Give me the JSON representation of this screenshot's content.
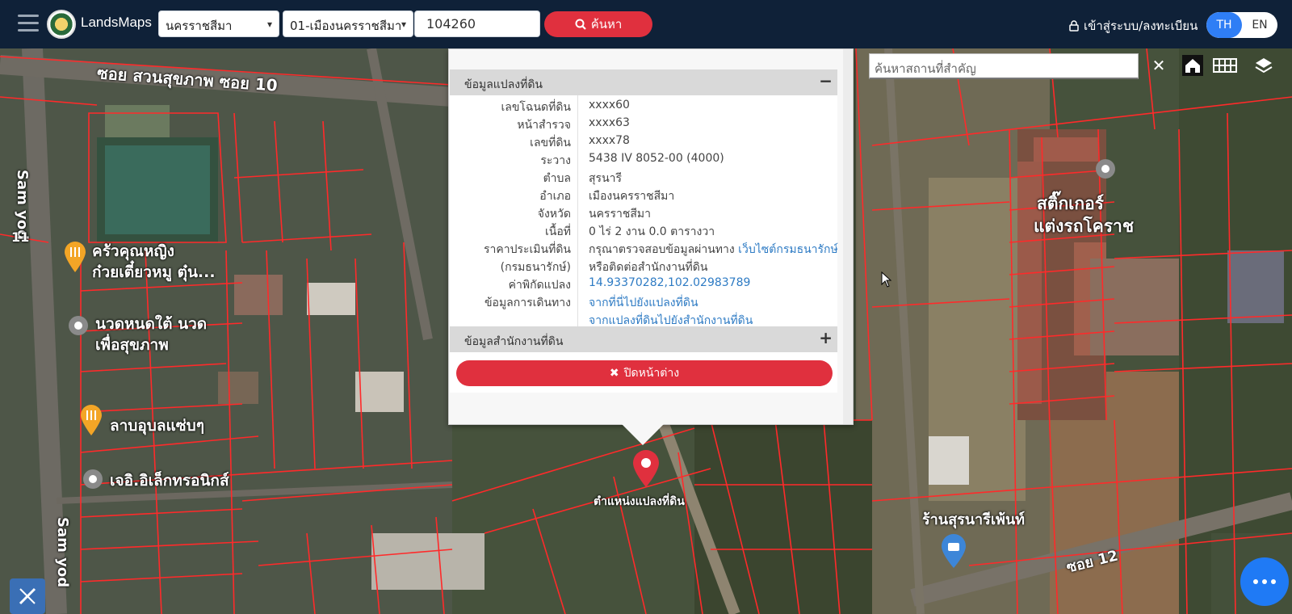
{
  "header": {
    "brand": "LandsMaps",
    "province": "นครราชสีมา",
    "district": "01-เมืองนครราชสีมา",
    "parcel_number": "104260",
    "search_label": "ค้นหา",
    "login_label": "เข้าสู่ระบบ/ลงทะเบียน",
    "lang_th": "TH",
    "lang_en": "EN"
  },
  "map": {
    "place_search_placeholder": "ค้นหาสถานที่สำคัญ",
    "labels": {
      "soi_suansuk": "ซอย สวนสุขภาพ ซอย 10",
      "sam_yod_top": "Sam yod",
      "sam_yod_bottom": "Sam yod",
      "num_11": "11",
      "restaurant": "ครัวคุณหญิง",
      "restaurant2": "ก๋วยเตี๋ยวหมู ตุ๋น...",
      "massage": "นวดหนดใต้ นวด",
      "massage2": "เพื่อสุขภาพ",
      "laab": "ลาบอุบลแซ่บๆ",
      "electronics": "เจอิ.อิเล็กทรอนิกส์",
      "sticker": "สติ๊กเกอร์",
      "sticker2": "แต่งรถโคราช",
      "paint_shop": "ร้านสุรนารีเพ้นท์",
      "soi12": "ซอย 12",
      "pin_label": "ตำแหน่งแปลงที่ดิน"
    }
  },
  "popup": {
    "section_parcel": "ข้อมูลแปลงที่ดิน",
    "section_office": "ข้อมูลสำนักงานที่ดิน",
    "close_label": "ปิดหน้าต่าง",
    "rows": [
      {
        "k": "เลขโฉนดที่ดิน",
        "v": "xxxx60"
      },
      {
        "k": "หน้าสำรวจ",
        "v": "xxxx63"
      },
      {
        "k": "เลขที่ดิน",
        "v": "xxxx78"
      },
      {
        "k": "ระวาง",
        "v": "5438 IV 8052-00 (4000)"
      },
      {
        "k": "ตำบล",
        "v": "สุรนารี"
      },
      {
        "k": "อำเภอ",
        "v": "เมืองนครราชสีมา"
      },
      {
        "k": "จังหวัด",
        "v": "นครราชสีมา"
      },
      {
        "k": "เนื้อที่",
        "v": "0 ไร่ 2 งาน 0.0 ตารางวา"
      }
    ],
    "price_key": "ราคาประเมินที่ดิน",
    "price_key2": "(กรมธนารักษ์)",
    "price_text": "กรุณาตรวจสอบข้อมูลผ่านทาง",
    "price_link": "เว็บไซต์กรมธนารักษ์",
    "price_text2": "หรือติดต่อสำนักงานที่ดิน",
    "coord_key": "ค่าพิกัดแปลง",
    "coord_value": "14.93370282,102.02983789",
    "travel_key": "ข้อมูลการเดินทาง",
    "travel_link1": "จากที่นี่ไปยังแปลงที่ดิน",
    "travel_link2": "จากแปลงที่ดินไปยังสำนักงานที่ดิน"
  },
  "colors": {
    "topbar": "#0f2138",
    "accent_red": "#e0303e",
    "accent_blue": "#2f7ef5",
    "parcel_line": "#ff2a2a"
  }
}
